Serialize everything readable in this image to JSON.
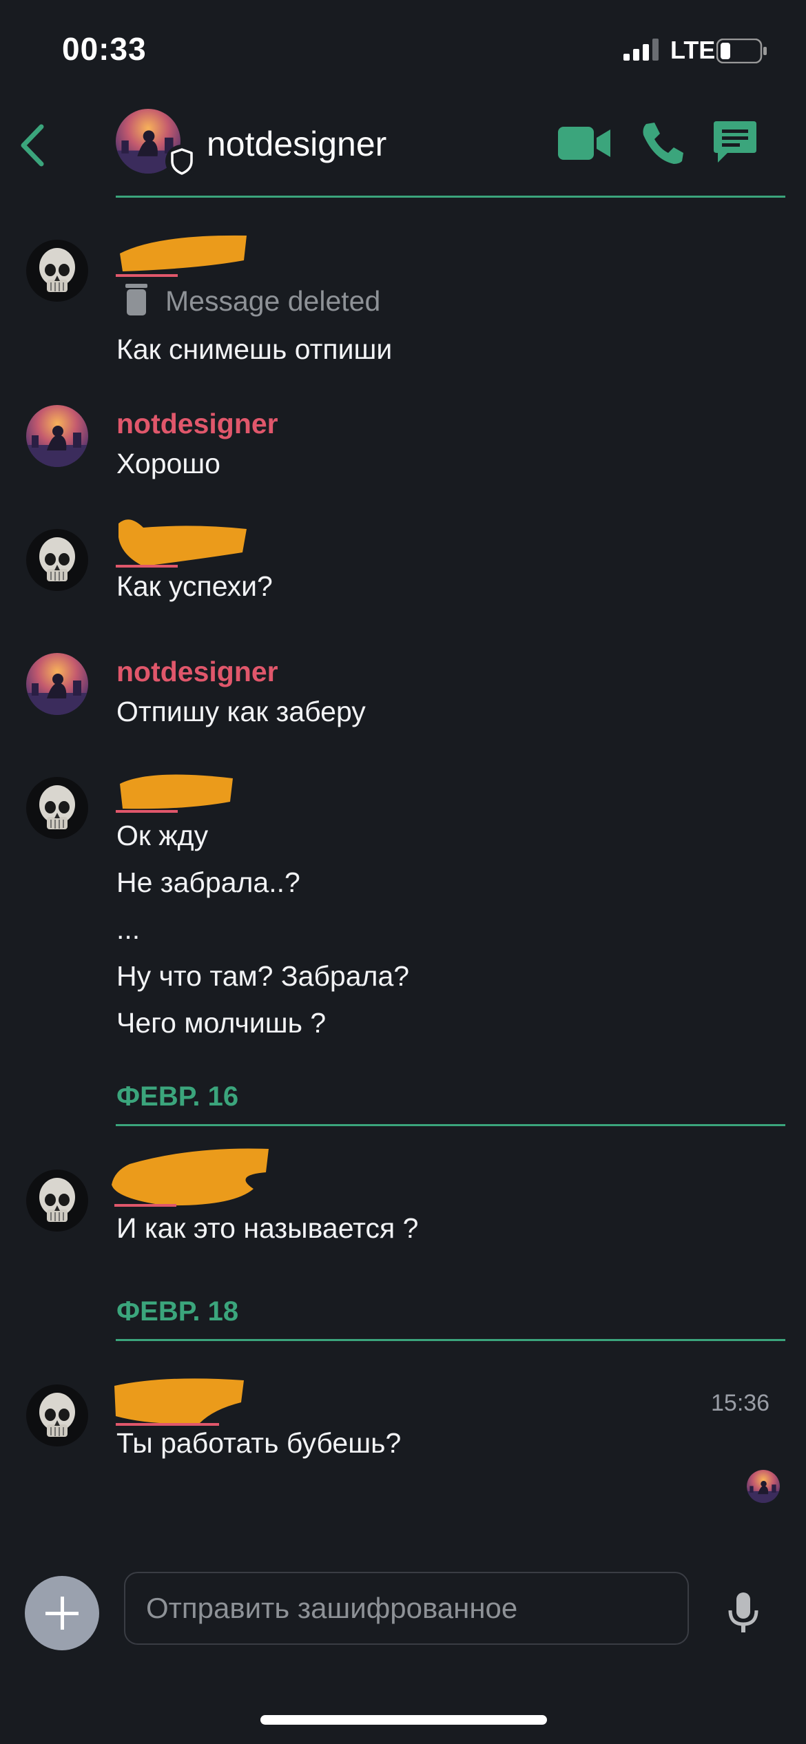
{
  "status_bar": {
    "time": "00:33",
    "network": "LTE"
  },
  "header": {
    "channel_name": "notdesigner"
  },
  "colors": {
    "accent": "#3ba57c",
    "username": "#e0576b",
    "background": "#181b20",
    "redaction": "#f7a21b"
  },
  "messages": [
    {
      "sender": "",
      "deleted_label": "Message deleted",
      "lines": [
        "Как снимешь отпиши"
      ]
    },
    {
      "sender": "notdesigner",
      "lines": [
        "Хорошо"
      ]
    },
    {
      "sender": "",
      "lines": [
        "Как успехи?"
      ]
    },
    {
      "sender": "notdesigner",
      "lines": [
        "Отпишу как заберу"
      ]
    },
    {
      "sender": "",
      "lines": [
        "Ок жду",
        "Не забрала..?",
        "...",
        "Ну что там? Забрала?",
        "Чего молчишь ?"
      ]
    },
    {
      "sender": "",
      "lines": [
        "И как это называется ?"
      ]
    },
    {
      "sender": "",
      "time": "15:36",
      "lines": [
        "Ты работать бубешь?"
      ]
    }
  ],
  "dividers": [
    "ФЕВР. 16",
    "ФЕВР. 18"
  ],
  "composer": {
    "placeholder": "Отправить зашифрованное"
  },
  "icons": [
    "back-arrow-icon",
    "shield-icon",
    "video-camera-icon",
    "phone-icon",
    "chat-bubble-icon",
    "trash-icon",
    "plus-icon",
    "microphone-icon"
  ]
}
